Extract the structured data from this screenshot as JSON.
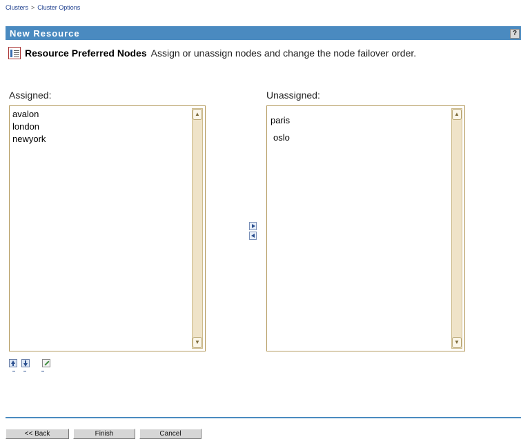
{
  "breadcrumb": {
    "items": [
      "Clusters",
      "Cluster Options"
    ],
    "separator": ">"
  },
  "title_bar": {
    "title": "New Resource",
    "help_label": "?"
  },
  "subheader": {
    "icon": "preferred-nodes-icon",
    "title": "Resource Preferred Nodes",
    "description": "Assign or unassign nodes and change the node failover order."
  },
  "assigned": {
    "label": "Assigned:",
    "items": [
      "avalon",
      "london",
      "newyork"
    ]
  },
  "unassigned": {
    "label": "Unassigned:",
    "items": [
      "paris",
      "oslo"
    ]
  },
  "footer": {
    "back_label": "<< Back",
    "finish_label": "Finish",
    "cancel_label": "Cancel"
  },
  "colors": {
    "title_bar": "#4a8ac0",
    "list_border": "#b49a5e",
    "scrollbar": "#efe3c8"
  }
}
